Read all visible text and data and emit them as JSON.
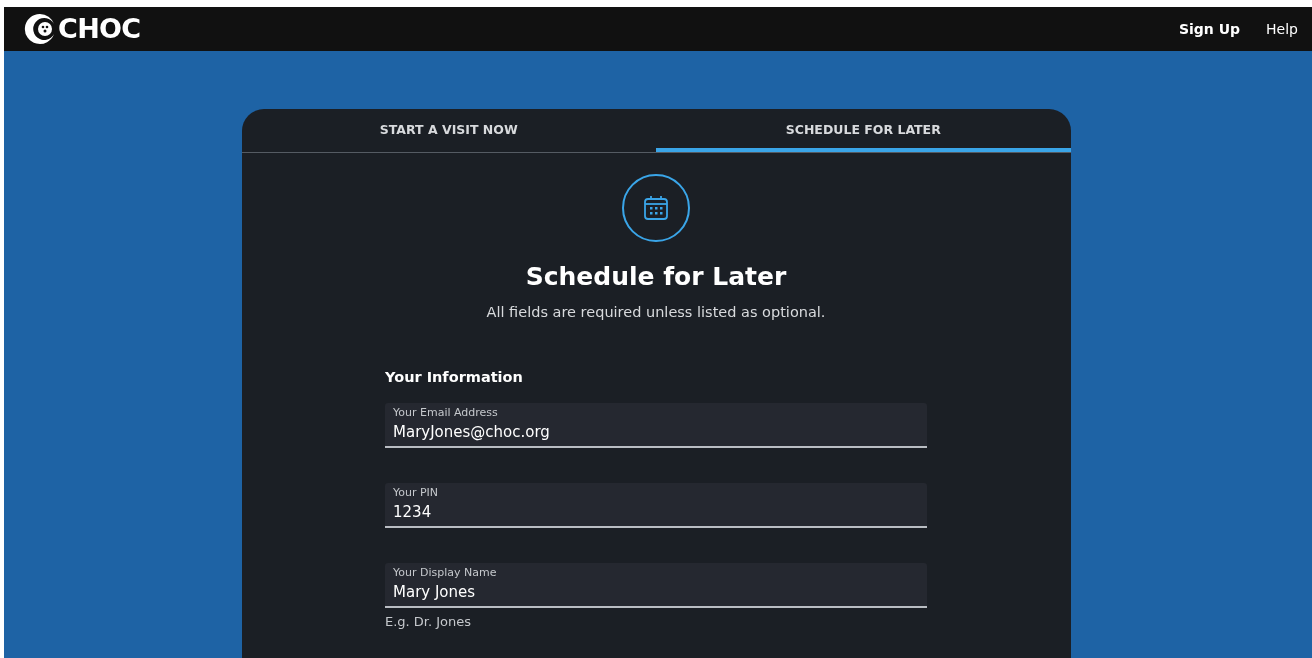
{
  "header": {
    "logo": "CHOC",
    "links": [
      "Sign Up",
      "Help"
    ]
  },
  "tabs": [
    {
      "label": "START A VISIT NOW",
      "selected": false
    },
    {
      "label": "SCHEDULE FOR LATER",
      "selected": true
    }
  ],
  "title": "Schedule for Later",
  "subtitle": "All fields are required unless listed as optional.",
  "section": "Your Information",
  "fields": [
    {
      "label": "Your Email Address",
      "value": "MaryJones@choc.org"
    },
    {
      "label": "Your PIN",
      "value": "1234"
    },
    {
      "label": "Your Display Name",
      "value": "Mary Jones",
      "hint": "E.g. Dr. Jones"
    }
  ]
}
